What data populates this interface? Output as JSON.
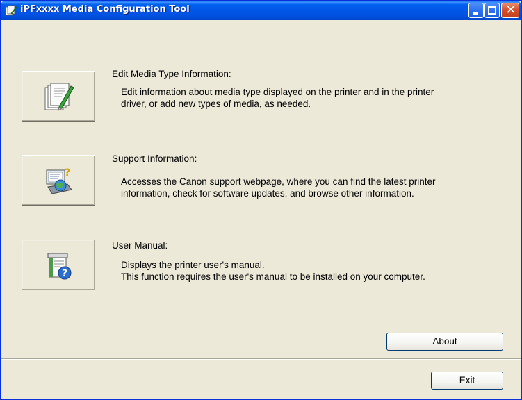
{
  "window": {
    "title": "iPFxxxx Media Configuration Tool"
  },
  "sections": [
    {
      "heading": "Edit Media Type Information:",
      "lines": [
        "Edit information about media type displayed on the printer and in the printer",
        "driver, or add new types of media, as needed."
      ],
      "icon": "edit-document-icon"
    },
    {
      "heading": "Support Information:",
      "lines": [
        "Accesses the Canon support webpage, where you can find the latest printer",
        "information, check for software updates, and browse other information."
      ],
      "icon": "support-globe-icon"
    },
    {
      "heading": "User Manual:",
      "lines": [
        "Displays the printer user's manual.",
        "This function requires the user's manual to be installed on your computer."
      ],
      "icon": "user-manual-help-icon"
    }
  ],
  "buttons": {
    "about": "About",
    "exit": "Exit"
  },
  "colors": {
    "titlebar": "#0055e5",
    "window_face": "#ece9d8",
    "close_button": "#d5522b"
  }
}
